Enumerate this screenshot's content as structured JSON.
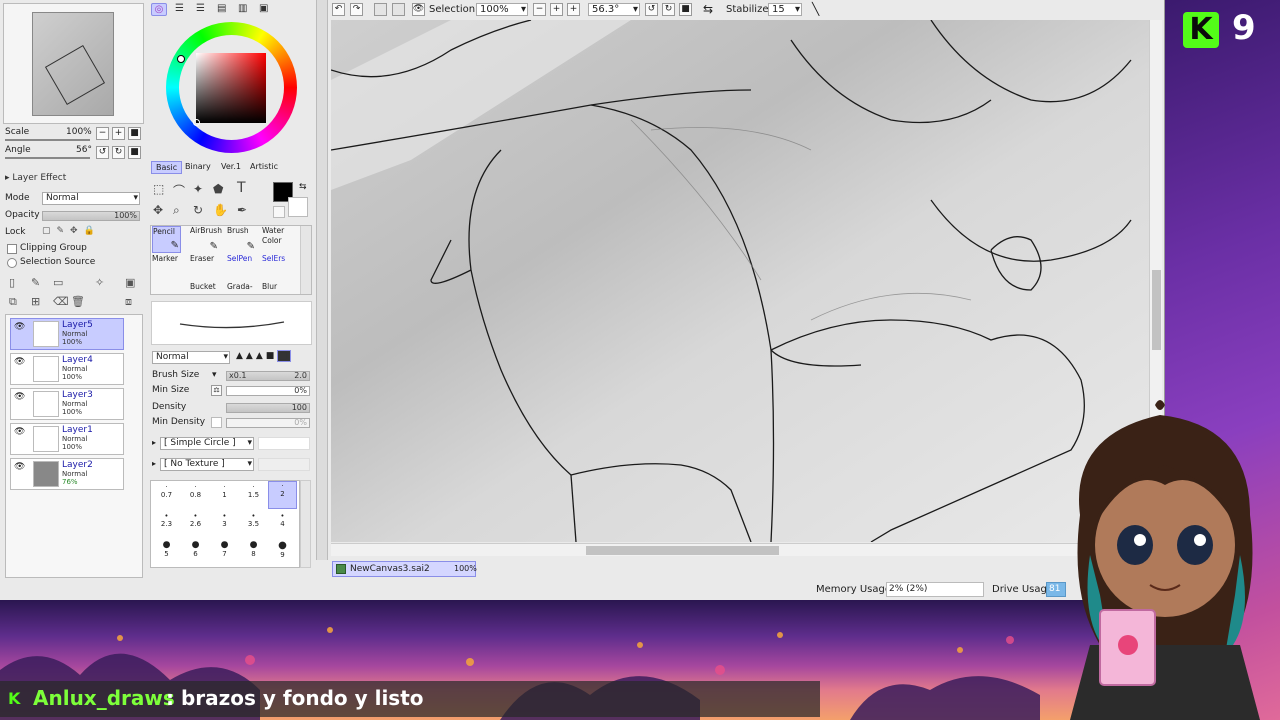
{
  "colors": {
    "accent_green": "#53fc18",
    "selected_layer": "#c8ccff",
    "canvas_bg": "#e4e4e4"
  },
  "navigator": {
    "scale_label": "Scale",
    "scale_value": "100%",
    "angle_label": "Angle",
    "angle_value": "56°"
  },
  "layer_panel": {
    "effect_label": "Layer Effect",
    "mode_label": "Mode",
    "mode_value": "Normal",
    "opacity_label": "Opacity",
    "opacity_value": "100%",
    "lock_label": "Lock",
    "clipping_group": "Clipping Group",
    "selection_source": "Selection Source",
    "layers": [
      {
        "name": "Layer5",
        "mode": "Normal",
        "opacity": "100%"
      },
      {
        "name": "Layer4",
        "mode": "Normal",
        "opacity": "100%"
      },
      {
        "name": "Layer3",
        "mode": "Normal",
        "opacity": "100%"
      },
      {
        "name": "Layer1",
        "mode": "Normal",
        "opacity": "100%"
      },
      {
        "name": "Layer2",
        "mode": "Normal",
        "opacity": "76%"
      }
    ]
  },
  "color_tabs": [
    "Basic",
    "Binary",
    "Ver.1",
    "Artistic"
  ],
  "tools": {
    "row1": [
      "Pencil",
      "AirBrush",
      "Brush",
      "Water Color"
    ],
    "row2": [
      "Marker",
      "Eraser",
      "SelPen",
      "SelErs"
    ],
    "row3": [
      "Bucket",
      "Grada-",
      "Blur"
    ]
  },
  "brush": {
    "blend_mode": "Normal",
    "size_label": "Brush Size",
    "size_mult": "x0.1",
    "size_value": "2.0",
    "min_size_label": "Min Size",
    "min_size_value": "0%",
    "density_label": "Density",
    "density_value": "100",
    "min_density_label": "Min Density",
    "min_density_value": "0%",
    "shape": "[ Simple Circle ]",
    "texture": "[ No Texture ]",
    "sizes_row1": [
      "0.7",
      "0.8",
      "1",
      "1.5",
      "2"
    ],
    "sizes_row2": [
      "2.3",
      "2.6",
      "3",
      "3.5",
      "4"
    ],
    "sizes_row3": [
      "5",
      "6",
      "7",
      "8",
      "9"
    ]
  },
  "toolbar": {
    "selection_label": "Selection",
    "zoom_value": "100%",
    "rotation_value": "56.3°",
    "stabilizer_label": "Stabilizer",
    "stabilizer_value": "15"
  },
  "document_tab": {
    "name": "NewCanvas3.sai2",
    "zoom": "100%"
  },
  "status": {
    "memory_label": "Memory Usage",
    "memory_value": "2% (2%)",
    "drive_label": "Drive Usage",
    "drive_value": "81"
  },
  "overlay": {
    "kick_badge": "K",
    "kick_count": "9",
    "chat_user": "Anlux_draws",
    "chat_message": ": brazos y fondo y listo"
  }
}
